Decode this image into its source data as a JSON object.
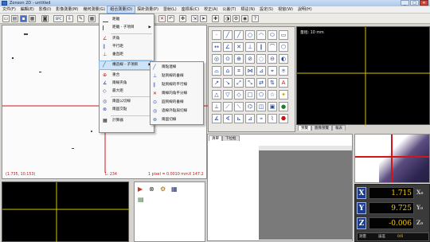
{
  "window": {
    "title": "Zonson 2D - untitled",
    "controls": [
      "_",
      "□",
      "✕"
    ]
  },
  "menubar": {
    "items": [
      "文件(F)",
      "編輯(E)",
      "影像(I)",
      "影像測量(M)",
      "幾何測量(G)",
      "組合測量(O)",
      "探針測量(P)",
      "雷射(L)",
      "座標系(C)",
      "校正(A)",
      "公差(T)",
      "標註(N)",
      "設定(S)",
      "視窗(W)",
      "說明(H)"
    ]
  },
  "dropdown": {
    "items": [
      "距離",
      "距離 - 子項目",
      "夾角",
      "平行距",
      "垂直距",
      "構造線 - 子項目",
      "重合",
      "兩線夾角",
      "最大距",
      "兩圓公切線",
      "兩圓交點",
      "計算器"
    ]
  },
  "submenu": {
    "items": [
      "兩點連線",
      "點到線的垂線",
      "點到線的平行線",
      "兩線的角平分線",
      "圓到線的垂線",
      "過線外點與切線",
      "兩圓切線"
    ]
  },
  "toolbar": {
    "icons": [
      "new-icon",
      "open-icon",
      "save-icon",
      "print-icon",
      "ccd-icon",
      "spc-icon",
      "export-icon",
      "pen-icon",
      "cancel-icon",
      "undo-icon",
      "move-icon",
      "select-icon",
      "light-icon",
      "camera-icon",
      "settings-icon",
      "zoom-icon",
      "help-icon"
    ],
    "spc_label": "SPC"
  },
  "camera": {
    "coord": "(1.735, 10.153)",
    "scale_label": "1 pixel = 0.0010 mm",
    "zoom_label": "X 147.2",
    "info": "L: 234"
  },
  "preview": {
    "scale_label": "量程: 10 mm"
  },
  "preview_tabs": [
    "預覽",
    "圖像預覽",
    "報表"
  ],
  "list_tabs": [
    "清單",
    "下拉框"
  ],
  "dro": {
    "rows": [
      {
        "axis": "X",
        "value": "1.715",
        "side": "X₀"
      },
      {
        "axis": "Y",
        "value": "9.725",
        "side": "Y₀"
      },
      {
        "axis": "Z",
        "value": "-0.006",
        "side": "Z₀"
      }
    ],
    "status_labels": [
      "測量",
      "誤差",
      "0/0"
    ]
  },
  "colors": {
    "crosshair_yellow": "#d6c400",
    "crosshair_red": "#d0161a",
    "dro_value": "#f0c810",
    "dro_axis": "#1e3c8c"
  }
}
